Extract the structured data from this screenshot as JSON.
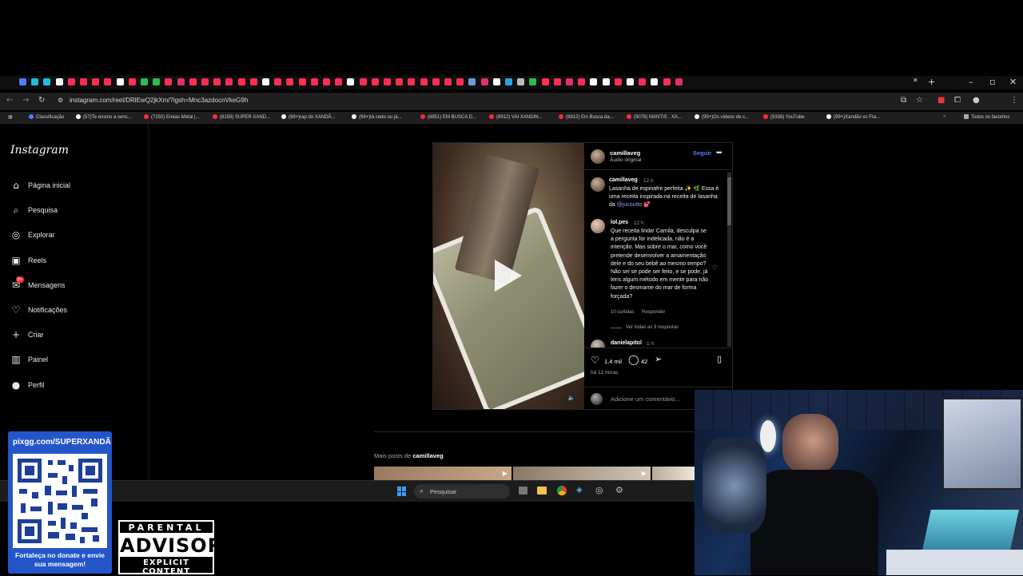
{
  "browser": {
    "url": "instagram.com/reel/DRlEwQ2jkXm/?igsh=Mnc3azdocnVkeG9h",
    "bookmarks": [
      {
        "label": "Classificação",
        "color": "#4f7cff"
      },
      {
        "label": "(57)Te ensino a venc...",
        "color": "#ffffff"
      },
      {
        "label": "(7292) Enéas Metal |...",
        "color": "#ff2d2d"
      },
      {
        "label": "(8159) SUPER XAND...",
        "color": "#ff2d2d"
      },
      {
        "label": "(99+)rap do XANDÃ...",
        "color": "#ffffff"
      },
      {
        "label": "(99+)tá cedo ou já...",
        "color": "#ffffff"
      },
      {
        "label": "(8851) EM BUSCA D...",
        "color": "#ff2d2d"
      },
      {
        "label": "(8912) VAI XANDIN...",
        "color": "#ff2d2d"
      },
      {
        "label": "(8912) Em Busca da...",
        "color": "#ff2d2d"
      },
      {
        "label": "(9078) MANTIS · XA...",
        "color": "#ff2d2d"
      },
      {
        "label": "(99+)Os vídeos de c...",
        "color": "#ffffff"
      },
      {
        "label": "(9338) YouTube",
        "color": "#ff2d2d"
      },
      {
        "label": "(99+)Xandão vs Fra...",
        "color": "#ffffff"
      }
    ],
    "all_bookmarks": "Todos os favoritos"
  },
  "sidebar": {
    "logo": "Instagram",
    "items": [
      {
        "label": "Página inicial",
        "icon": "home-icon"
      },
      {
        "label": "Pesquisa",
        "icon": "search-icon"
      },
      {
        "label": "Explorar",
        "icon": "compass-icon"
      },
      {
        "label": "Reels",
        "icon": "reels-icon"
      },
      {
        "label": "Mensagens",
        "icon": "messenger-icon",
        "badge": "9+"
      },
      {
        "label": "Notificações",
        "icon": "heart-icon"
      },
      {
        "label": "Criar",
        "icon": "plus-icon"
      },
      {
        "label": "Painel",
        "icon": "dashboard-icon"
      },
      {
        "label": "Perfil",
        "icon": "profile-avatar"
      }
    ]
  },
  "post": {
    "author": "camillaveg",
    "audio": "Áudio original",
    "follow": "Seguir",
    "caption": {
      "user": "camillaveg",
      "time": "12 h",
      "text_before": "Lasanha de espinafre perfeita ✨ 🌿 Essa é uma receita inspirada na receita de lasanha da ",
      "mention": "@jucoutto",
      "text_after": " 💕"
    },
    "comments": [
      {
        "user": "lol.pes",
        "time": "12 h",
        "text": "Que receita linda! Camila, desculpa se a pergunta for indelicada, não é a intenção. Mas sobre o mar, como você pretende desenvolver a amamentação dele e do seu bebê ao mesmo tempo? Não sei se pode ser feito, e se pode, já tens algum método em mente para não fazer o desmame do mar de forma forçada?",
        "likes": "10 curtidas",
        "reply": "Responder",
        "view_replies": "Ver todas as 9 respostas"
      },
      {
        "user": "danielapitol",
        "time": "1 h"
      }
    ],
    "likes": "1,4 mil",
    "comment_count": "42",
    "posted": "há 12 horas",
    "add_comment_placeholder": "Adicione um comentário..."
  },
  "more_posts": {
    "prefix": "Mais posts de ",
    "author": "camillaveg"
  },
  "taskbar": {
    "search": "Pesquisar"
  },
  "overlay": {
    "qr_url": "pixgg.com/SUPERXANDÃ",
    "qr_note": "Fortaleça no donate e envie sua mensagem!",
    "advisory_line1": "PARENTAL",
    "advisory_line2": "ADVISORY",
    "advisory_line3": "EXPLICIT CONTENT"
  }
}
